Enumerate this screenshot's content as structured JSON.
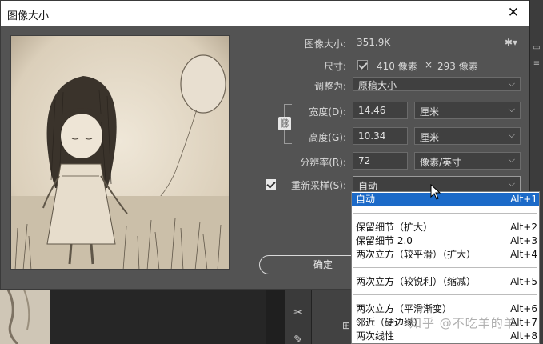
{
  "dialog": {
    "title": "图像大小",
    "close_glyph": "✕",
    "image_size_label": "图像大小:",
    "image_size_value": "351.9K",
    "dimensions_label": "尺寸:",
    "dimensions_width": "410 像素",
    "dimensions_sep": "×",
    "dimensions_height": "293 像素",
    "fit_to_label": "调整为:",
    "fit_to_value": "原稿大小",
    "width_label": "宽度(D):",
    "width_value": "14.46",
    "width_unit": "厘米",
    "height_label": "高度(G):",
    "height_value": "10.34",
    "height_unit": "厘米",
    "resolution_label": "分辨率(R):",
    "resolution_value": "72",
    "resolution_unit": "像素/英寸",
    "resample_label": "重新采样(S):",
    "resample_checked": true,
    "resample_value": "自动",
    "ok_label": "确定",
    "gear_icon": "gear-icon",
    "link_icon": "chain-link-icon"
  },
  "resample_menu": {
    "items": [
      {
        "label": "自动",
        "shortcut": "Alt+1",
        "selected": true
      },
      {
        "label": "保留细节（扩大）",
        "shortcut": "Alt+2"
      },
      {
        "label": "保留细节 2.0",
        "shortcut": "Alt+3"
      },
      {
        "label": "两次立方（较平滑）（扩大）",
        "shortcut": "Alt+4"
      },
      {
        "label": "两次立方（较锐利）（缩减）",
        "shortcut": "Alt+5"
      },
      {
        "label": "两次立方（平滑渐变）",
        "shortcut": "Alt+6"
      },
      {
        "label": "邻近（硬边缘）",
        "shortcut": "Alt+7"
      },
      {
        "label": "两次线性",
        "shortcut": "Alt+8"
      }
    ]
  },
  "watermark": "知乎 @不吃羊的羊",
  "colors": {
    "dialog_bg": "#535353",
    "menu_selected": "#1c6ac8",
    "field_bg": "#404040"
  }
}
